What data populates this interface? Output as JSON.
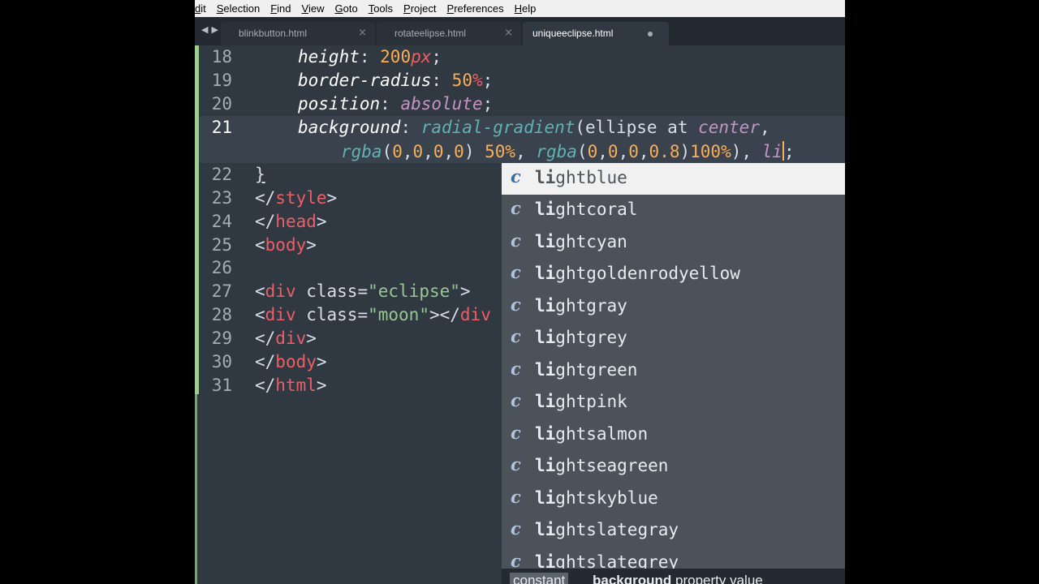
{
  "menu": [
    "dit",
    "Selection",
    "Find",
    "View",
    "Goto",
    "Tools",
    "Project",
    "Preferences",
    "Help"
  ],
  "tabs": [
    {
      "label": "blinkbutton.html",
      "state": "close"
    },
    {
      "label": "rotateelipse.html",
      "state": "close"
    },
    {
      "label": "uniqueeclipse.html",
      "state": "dirty"
    }
  ],
  "tab_close_glyph": "×",
  "line_numbers": [
    "18",
    "19",
    "20",
    "21",
    "",
    "22",
    "23",
    "24",
    "25",
    "26",
    "27",
    "28",
    "29",
    "30",
    "31"
  ],
  "code": {
    "l18": {
      "prop": "height",
      "colon": ": ",
      "num": "200",
      "unit": "px",
      "end": ";"
    },
    "l19": {
      "prop": "border-radius",
      "colon": ": ",
      "num": "50",
      "unit": "%",
      "end": ";"
    },
    "l20": {
      "prop": "position",
      "colon": ": ",
      "val": "absolute",
      "end": ";"
    },
    "l21": {
      "prop": "background",
      "colon": ": ",
      "fn": "radial-gradient",
      "args": "(ellipse at ",
      "val": "center",
      "comma": ","
    },
    "l21b": {
      "fn1": "rgba",
      "args1a": "(",
      "n0": "0",
      "c1": ",",
      "n1": "0",
      "c2": ",",
      "n2": "0",
      "c3": ",",
      "n3": "0",
      "close1": ")",
      "sp1": " ",
      "pct1": "50%",
      "comma1": ", ",
      "fn2": "rgba",
      "args2a": "(",
      "m0": "0",
      "d1": ",",
      "m1": "0",
      "d2": ",",
      "m2": "0",
      "d3": ",",
      "m3": "0.8",
      "close2": ")",
      "pct2": "100%",
      "close3": "), ",
      "typed": "li",
      "end": ";"
    },
    "l22": "}",
    "l23": {
      "open": "</",
      "tag": "style",
      "close": ">"
    },
    "l24": {
      "open": "</",
      "tag": "head",
      "close": ">"
    },
    "l25": {
      "open": "<",
      "tag": "body",
      "close": ">"
    },
    "l27": {
      "open": "<",
      "tag": "div",
      "attr": " class",
      "eq": "=",
      "str": "\"eclipse\"",
      "close": ">"
    },
    "l28": {
      "open": "<",
      "tag": "div",
      "attr": " class",
      "eq": "=",
      "str": "\"moon\"",
      "close": "></",
      "tag2": "div"
    },
    "l29": {
      "open": "</",
      "tag": "div",
      "close": ">"
    },
    "l30": {
      "open": "</",
      "tag": "body",
      "close": ">"
    },
    "l31": {
      "open": "</",
      "tag": "html",
      "close": ">"
    }
  },
  "autocomplete": {
    "kind": "c",
    "match": "li",
    "items": [
      {
        "rest": "ghtblue",
        "selected": true
      },
      {
        "rest": "ghtcoral"
      },
      {
        "rest": "ghtcyan"
      },
      {
        "rest": "ghtgoldenrodyellow"
      },
      {
        "rest": "ghtgray"
      },
      {
        "rest": "ghtgrey"
      },
      {
        "rest": "ghtgreen"
      },
      {
        "rest": "ghtpink"
      },
      {
        "rest": "ghtsalmon"
      },
      {
        "rest": "ghtseagreen"
      },
      {
        "rest": "ghtskyblue"
      },
      {
        "rest": "ghtslategray"
      },
      {
        "rest": "ghtslategrey"
      }
    ],
    "footer_kind": "constant",
    "footer_bold": "background",
    "footer_rest": " property value"
  },
  "colors": {
    "editor_bg": "#303841",
    "keyword": "#ec5f67",
    "number": "#f9ae58",
    "string": "#99c794",
    "function": "#5fb3b3",
    "value": "#c594c5"
  }
}
